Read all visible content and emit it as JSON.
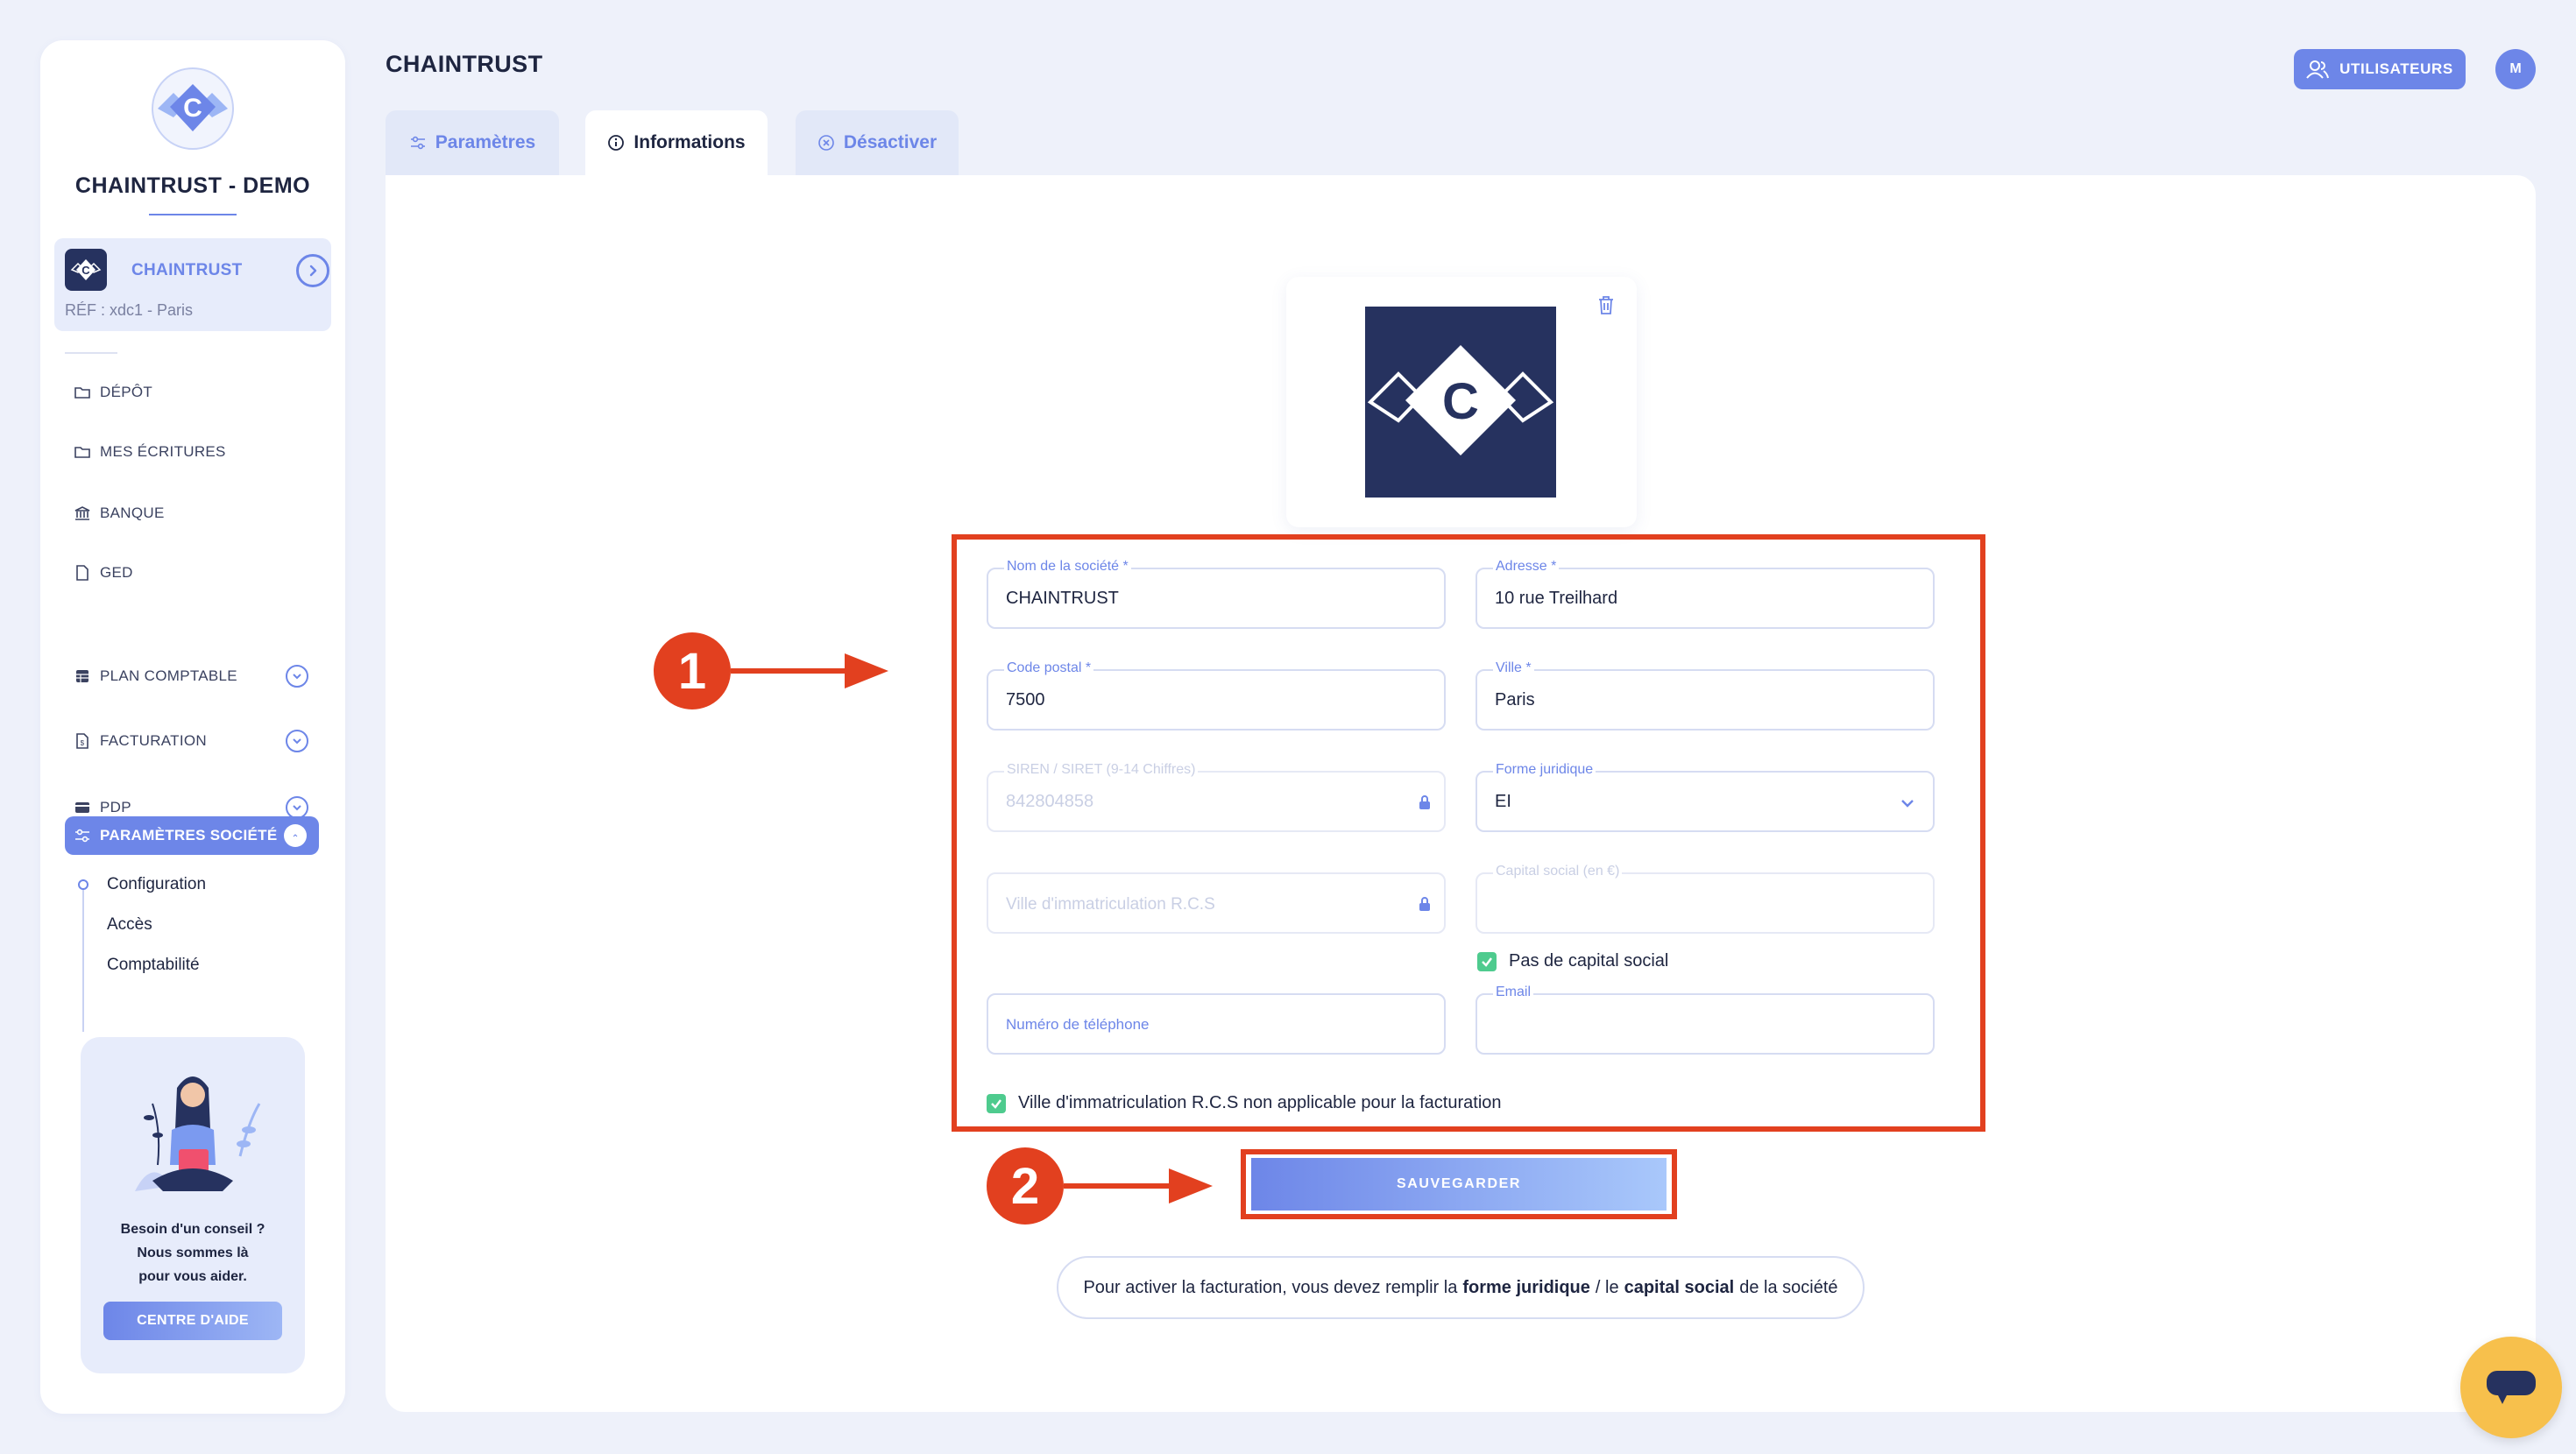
{
  "sidebar": {
    "brand": "CHAINTRUST - DEMO",
    "company": {
      "name": "CHAINTRUST",
      "ref": "RÉF : xdc1 - Paris"
    },
    "items": [
      {
        "label": "DÉPÔT",
        "icon": "folder-upload-icon"
      },
      {
        "label": "MES ÉCRITURES",
        "icon": "folder-icon"
      },
      {
        "label": "BANQUE",
        "icon": "bank-icon"
      },
      {
        "label": "GED",
        "icon": "document-icon"
      },
      {
        "label": "PLAN COMPTABLE",
        "icon": "table-icon"
      },
      {
        "label": "FACTURATION",
        "icon": "invoice-icon"
      },
      {
        "label": "PDP",
        "icon": "card-icon"
      }
    ],
    "active": "PARAMÈTRES SOCIÉTÉ",
    "sub_items": [
      "Configuration",
      "Accès",
      "Comptabilité"
    ],
    "help": {
      "line1": "Besoin d'un conseil ?",
      "line2": "Nous sommes là",
      "line3": "pour vous aider.",
      "button": "CENTRE D'AIDE"
    }
  },
  "header": {
    "title": "CHAINTRUST",
    "users_button": "UTILISATEURS",
    "avatar_initial": "M"
  },
  "tabs": [
    {
      "label": "Paramètres",
      "active": false
    },
    {
      "label": "Informations",
      "active": true
    },
    {
      "label": "Désactiver",
      "active": false
    }
  ],
  "form": {
    "company_name": {
      "label": "Nom de la société *",
      "value": "CHAINTRUST"
    },
    "address": {
      "label": "Adresse *",
      "value": "10 rue Treilhard"
    },
    "postal_code": {
      "label": "Code postal *",
      "value": "7500"
    },
    "city": {
      "label": "Ville *",
      "value": "Paris"
    },
    "siren": {
      "label": "SIREN / SIRET (9-14 Chiffres)",
      "value": "842804858"
    },
    "legal_form": {
      "label": "Forme juridique",
      "value": "EI"
    },
    "rcs_city": {
      "placeholder": "Ville d'immatriculation R.C.S"
    },
    "capital": {
      "label": "Capital social (en €)"
    },
    "no_capital": {
      "label": "Pas de capital social",
      "checked": true
    },
    "phone": {
      "placeholder": "Numéro de téléphone"
    },
    "email": {
      "label": "Email"
    },
    "rcs_na": {
      "label": "Ville d'immatriculation R.C.S non applicable pour la facturation",
      "checked": true
    }
  },
  "save_button": "SAUVEGARDER",
  "annotations": {
    "step1": "1",
    "step2": "2"
  },
  "info": {
    "prefix": "Pour activer la facturation, vous devez remplir la",
    "bold1": "forme juridique",
    "middle": "/ le",
    "bold2": "capital social",
    "suffix": "de la société"
  },
  "colors": {
    "accent": "#6d86e8",
    "navy": "#26325f",
    "highlight": "#e2401f",
    "check": "#4ecb8e",
    "chat": "#f7c04c"
  }
}
